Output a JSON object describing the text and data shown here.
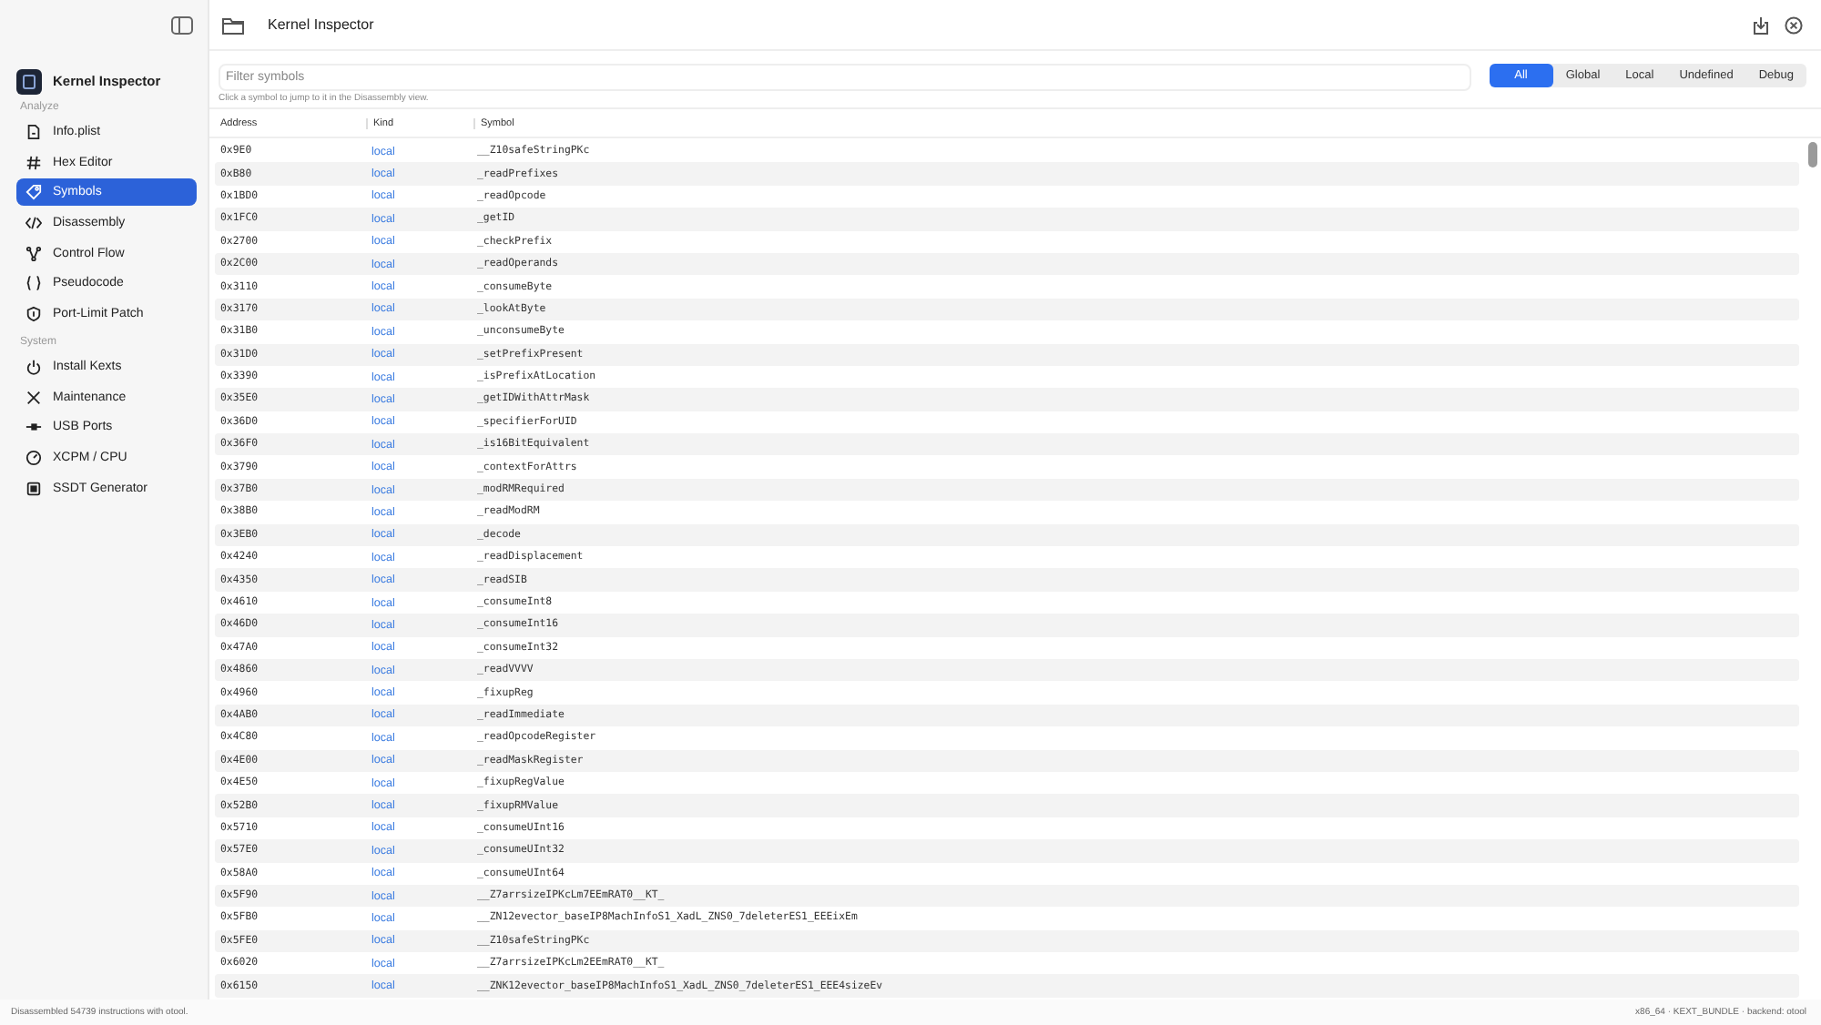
{
  "window": {
    "title": "Kernel Inspector"
  },
  "sidebar": {
    "app_name": "Kernel Inspector",
    "sections": [
      {
        "title": "Analyze",
        "items": [
          {
            "label": "Info.plist",
            "selected": false
          },
          {
            "label": "Hex Editor",
            "selected": false
          },
          {
            "label": "Symbols",
            "selected": true
          },
          {
            "label": "Disassembly",
            "selected": false
          },
          {
            "label": "Control Flow",
            "selected": false
          },
          {
            "label": "Pseudocode",
            "selected": false
          },
          {
            "label": "Port-Limit Patch",
            "selected": false
          }
        ]
      },
      {
        "title": "System",
        "items": [
          {
            "label": "Install Kexts",
            "selected": false
          },
          {
            "label": "Maintenance",
            "selected": false
          },
          {
            "label": "USB Ports",
            "selected": false
          },
          {
            "label": "XCPM / CPU",
            "selected": false
          },
          {
            "label": "SSDT Generator",
            "selected": false
          }
        ]
      }
    ]
  },
  "search": {
    "placeholder": "Filter symbols",
    "hint": "Click a symbol to jump to it in the Disassembly view."
  },
  "filters": [
    {
      "label": "All",
      "selected": true
    },
    {
      "label": "Global",
      "selected": false
    },
    {
      "label": "Local",
      "selected": false
    },
    {
      "label": "Undefined",
      "selected": false
    },
    {
      "label": "Debug",
      "selected": false
    }
  ],
  "table": {
    "columns": [
      "Address",
      "Kind",
      "Symbol"
    ],
    "rows": [
      [
        "0x9E0",
        "local",
        "__Z10safeStringPKc"
      ],
      [
        "0xB80",
        "local",
        "_readPrefixes"
      ],
      [
        "0x1BD0",
        "local",
        "_readOpcode"
      ],
      [
        "0x1FC0",
        "local",
        "_getID"
      ],
      [
        "0x2700",
        "local",
        "_checkPrefix"
      ],
      [
        "0x2C00",
        "local",
        "_readOperands"
      ],
      [
        "0x3110",
        "local",
        "_consumeByte"
      ],
      [
        "0x3170",
        "local",
        "_lookAtByte"
      ],
      [
        "0x31B0",
        "local",
        "_unconsumeByte"
      ],
      [
        "0x31D0",
        "local",
        "_setPrefixPresent"
      ],
      [
        "0x3390",
        "local",
        "_isPrefixAtLocation"
      ],
      [
        "0x35E0",
        "local",
        "_getIDWithAttrMask"
      ],
      [
        "0x36D0",
        "local",
        "_specifierForUID"
      ],
      [
        "0x36F0",
        "local",
        "_is16BitEquivalent"
      ],
      [
        "0x3790",
        "local",
        "_contextForAttrs"
      ],
      [
        "0x37B0",
        "local",
        "_modRMRequired"
      ],
      [
        "0x38B0",
        "local",
        "_readModRM"
      ],
      [
        "0x3EB0",
        "local",
        "_decode"
      ],
      [
        "0x4240",
        "local",
        "_readDisplacement"
      ],
      [
        "0x4350",
        "local",
        "_readSIB"
      ],
      [
        "0x4610",
        "local",
        "_consumeInt8"
      ],
      [
        "0x46D0",
        "local",
        "_consumeInt16"
      ],
      [
        "0x47A0",
        "local",
        "_consumeInt32"
      ],
      [
        "0x4860",
        "local",
        "_readVVVV"
      ],
      [
        "0x4960",
        "local",
        "_fixupReg"
      ],
      [
        "0x4AB0",
        "local",
        "_readImmediate"
      ],
      [
        "0x4C80",
        "local",
        "_readOpcodeRegister"
      ],
      [
        "0x4E00",
        "local",
        "_readMaskRegister"
      ],
      [
        "0x4E50",
        "local",
        "_fixupRegValue"
      ],
      [
        "0x52B0",
        "local",
        "_fixupRMValue"
      ],
      [
        "0x5710",
        "local",
        "_consumeUInt16"
      ],
      [
        "0x57E0",
        "local",
        "_consumeUInt32"
      ],
      [
        "0x58A0",
        "local",
        "_consumeUInt64"
      ],
      [
        "0x5F90",
        "local",
        "__Z7arrsizeIPKcLm7EEmRAT0__KT_"
      ],
      [
        "0x5FB0",
        "local",
        "__ZN12evector_baseIP8MachInfoS1_XadL_ZNS0_7deleterES1_EEEixEm"
      ],
      [
        "0x5FE0",
        "local",
        "__Z10safeStringPKc"
      ],
      [
        "0x6020",
        "local",
        "__Z7arrsizeIPKcLm2EEmRAT0__KT_"
      ],
      [
        "0x6150",
        "local",
        "__ZNK12evector_baseIP8MachInfoS1_XadL_ZNS0_7deleterES1_EEE4sizeEv"
      ]
    ]
  },
  "status_bar": {
    "left": "Disassembled 54739 instructions with otool.",
    "right": "x86_64 · KEXT_BUNDLE · backend: otool"
  }
}
